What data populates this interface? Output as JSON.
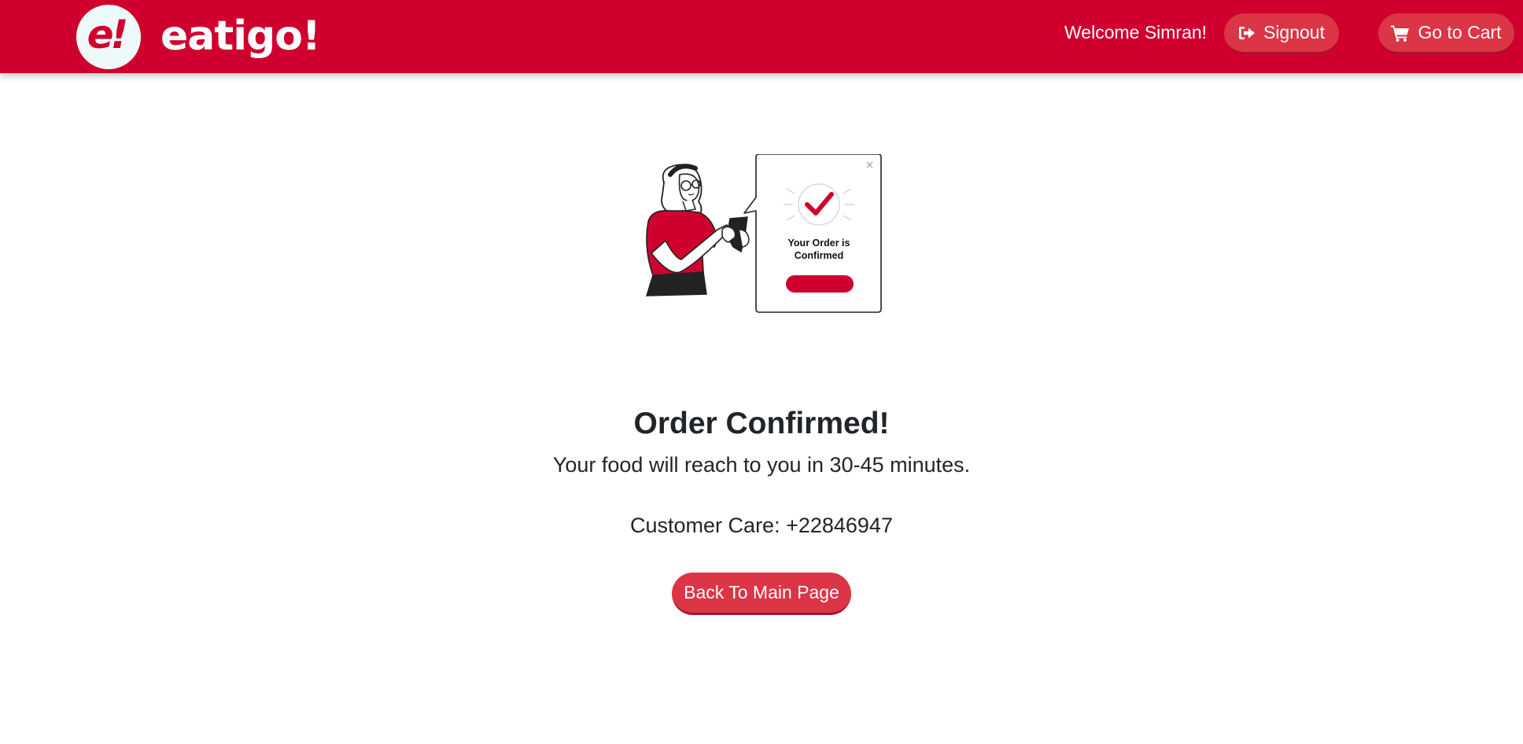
{
  "header": {
    "logo_mark": "e!",
    "brand_name": "eatigo!",
    "welcome_text": "Welcome Simran!",
    "signout_label": "Signout",
    "signout_icon": "sign-out-icon",
    "cart_label": "Go to Cart",
    "cart_icon": "shopping-cart-icon"
  },
  "illustration": {
    "card_title_line1": "Your Order is",
    "card_title_line2": "Confirmed",
    "card_icon": "checkmark-icon"
  },
  "main": {
    "title": "Order Confirmed!",
    "delivery_message": "Your food will reach to you in 30-45 minutes.",
    "customer_care": "Customer Care: +22846947",
    "back_button_label": "Back To Main Page"
  },
  "colors": {
    "brand_red": "#d0002e",
    "button_red": "#dc3545",
    "logo_bg": "#eef9fa",
    "text_dark": "#212529"
  }
}
